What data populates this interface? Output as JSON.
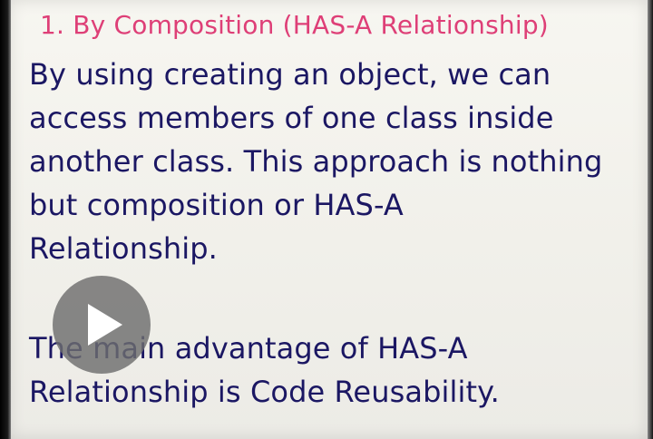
{
  "slide": {
    "title": "1. By Composition (HAS-A Relationship)",
    "paragraph_1": [
      "By using creating an object, we can",
      "access members of one class inside",
      "another class. This approach is nothing",
      "but composition or HAS-A",
      "Relationship."
    ],
    "paragraph_2": [
      "The main advantage of HAS-A",
      "Relationship is Code Reusability."
    ]
  },
  "player": {
    "play_icon": "play-icon"
  },
  "colors": {
    "title": "#de3f77",
    "body": "#1b1763",
    "play_button": "#6e6e6e"
  }
}
